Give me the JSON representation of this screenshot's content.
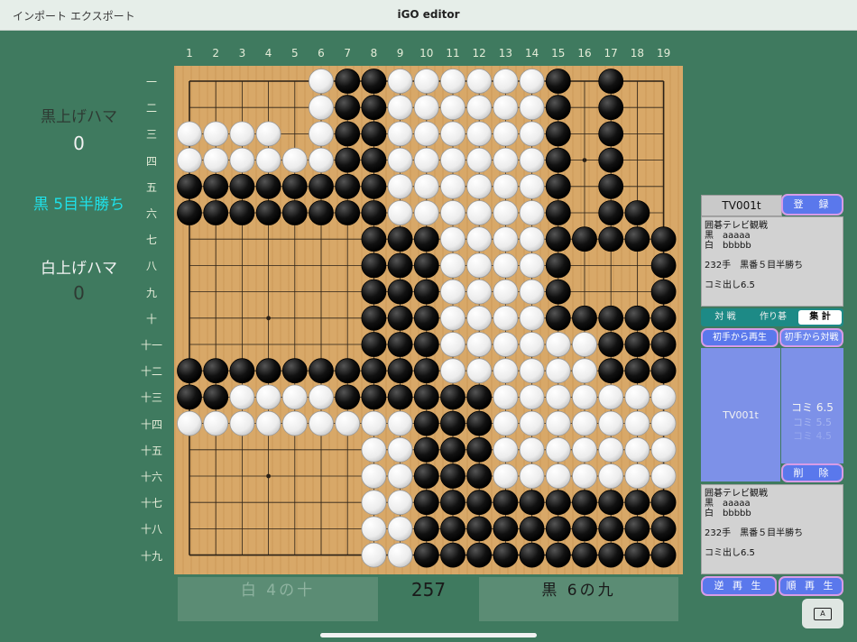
{
  "menu": {
    "import": "インポート",
    "export": "エクスポート"
  },
  "app_title": "iGO editor",
  "board": {
    "col_labels": [
      "1",
      "2",
      "3",
      "4",
      "5",
      "6",
      "7",
      "8",
      "9",
      "10",
      "11",
      "12",
      "13",
      "14",
      "15",
      "16",
      "17",
      "18",
      "19"
    ],
    "row_labels": [
      "一",
      "二",
      "三",
      "四",
      "五",
      "六",
      "七",
      "八",
      "九",
      "十",
      "十一",
      "十二",
      "十三",
      "十四",
      "十五",
      "十六",
      "十七",
      "十八",
      "十九"
    ],
    "stones": [
      "_____WBBWWWWWWB_B__",
      "_____WBBWWWWWWB_B__",
      "WWWW_WBBWWWWWWB_B__",
      "WWWWWWBBWWWWWWB_B__",
      "BBBBBBBBWWWWWWB_B__",
      "BBBBBBBBWWWWWWB_BB_",
      "_______BBBWWWWBBBBB",
      "_______BBBWWWWB___B",
      "_______BBBWWWWB___B",
      "_______BBBWWWWBBBBB",
      "_______BBBWWWWWWBBB",
      "BBBBBBBBBBWWWWWWBBB",
      "BBWWWWBBBBBBWWWWWWW",
      "WWWWWWWWWBBBWWWWWWW",
      "_______WWBBBWWWWWWW",
      "_______WWBBBWWWWWWW",
      "_______WWBBBBBBBBBB",
      "_______WWBBBBBBBBBB",
      "_______WWBBBBBBBBBB"
    ],
    "colors": {
      "wood": "#d6a564",
      "line": "#2a2016",
      "black": "#111111",
      "white": "#f4f4f4"
    }
  },
  "left": {
    "black_captures_label": "黒上げハマ",
    "black_captures": "0",
    "result": "黒 5目半勝ち",
    "white_captures_label": "白上げハマ",
    "white_captures": "0"
  },
  "bottom": {
    "last_white_move": "白 4の十",
    "move_count": "257",
    "last_black_move": "黒 6の九"
  },
  "panel": {
    "record_title": "TV001t",
    "register": "登　録",
    "info_text": "囲碁テレビ観戦\n黒　aaaaa\n白　bbbbb\n\n232手　黒番５目半勝ち\n\nコミ出し6.5",
    "tabs": [
      "対 戦",
      "作り碁",
      "集 計"
    ],
    "selected_tab": "集 計",
    "replay_from_start": "初手から再生",
    "versus_from_start": "初手から対戦",
    "record_item": "TV001t",
    "komi_options": [
      "コミ 6.5",
      "コミ 5.5",
      "コミ 4.5"
    ],
    "delete": "削　除",
    "detail_text": "囲碁テレビ観戦\n黒　aaaaa\n白　bbbbb\n\n232手　黒番５目半勝ち\n\nコミ出し6.5",
    "reverse_play": "逆 再 生",
    "forward_play": "順 再 生",
    "font_button": "A"
  },
  "colors": {
    "accent_cyan": "#1fe0e8",
    "accent_blue": "#5a78ec",
    "background": "#3f7a5f"
  }
}
